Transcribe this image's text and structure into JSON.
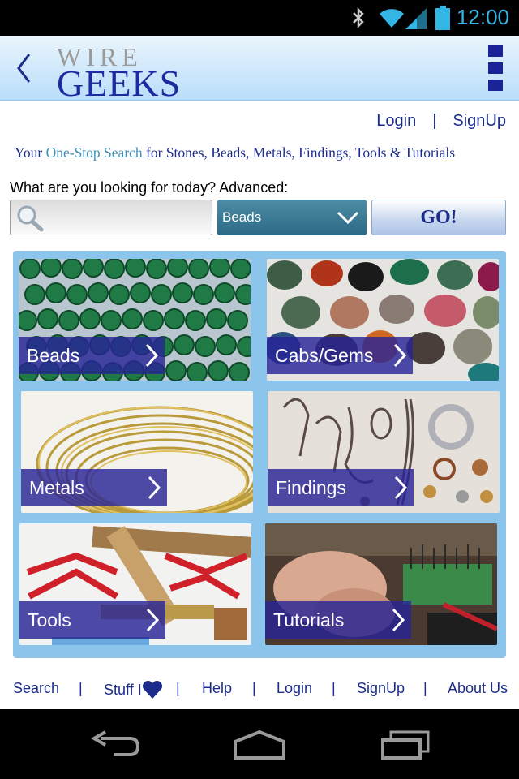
{
  "status_bar": {
    "time": "12:00"
  },
  "header": {
    "logo_top": "WIRE",
    "logo_bottom": "GEEKS"
  },
  "auth": {
    "login": "Login",
    "separator": "|",
    "signup": "SignUp"
  },
  "tagline": {
    "prefix": "Your ",
    "highlight": "One-Stop Search",
    "suffix": " for Stones, Beads, Metals, Findings, Tools & Tutorials"
  },
  "search": {
    "question": "What are you looking for today? Advanced:",
    "input_value": "",
    "category_selected": "Beads",
    "go_label": "GO!"
  },
  "categories": [
    {
      "label": "Beads"
    },
    {
      "label": "Cabs/Gems"
    },
    {
      "label": "Metals"
    },
    {
      "label": "Findings"
    },
    {
      "label": "Tools"
    },
    {
      "label": "Tutorials"
    }
  ],
  "footer": {
    "search": "Search",
    "stuff": "Stuff I",
    "help": "Help",
    "login": "Login",
    "signup": "SignUp",
    "about": "About Us",
    "separator": "|"
  },
  "colors": {
    "accent": "#1b2c8c",
    "grid_bg": "#8cc5ec",
    "label_bg": "#28249a"
  }
}
